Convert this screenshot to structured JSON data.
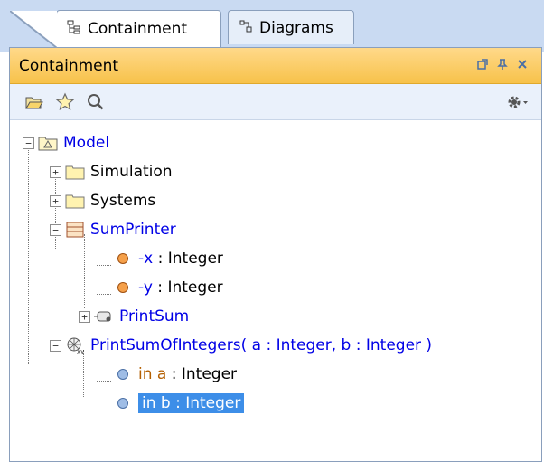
{
  "tabs": [
    {
      "label": "Containment",
      "icon": "containment-tree-icon",
      "active": true
    },
    {
      "label": "Diagrams",
      "icon": "diagram-icon",
      "active": false
    }
  ],
  "panel": {
    "title": "Containment",
    "titlebar_buttons": [
      "restore-icon",
      "pin-icon",
      "close-icon"
    ]
  },
  "toolbar": {
    "buttons": [
      "open-folder-icon",
      "star-icon",
      "search-icon"
    ],
    "options": "gear-icon"
  },
  "tree": {
    "model": "Model",
    "simulation": "Simulation",
    "systems": "Systems",
    "sumprinter": "SumPrinter",
    "attr_x_name": "-x",
    "attr_x_type": " : Integer",
    "attr_y_name": "-y",
    "attr_y_type": " : Integer",
    "printsum": "PrintSum",
    "op": "PrintSumOfIntegers( a : Integer, b : Integer )",
    "param_a_name": "in a",
    "param_a_type": " : Integer",
    "param_b": "in b : Integer"
  },
  "colors": {
    "tab_strip": "#c9daf2",
    "title_bar": "#f7c24a",
    "selection": "#3d8ee8",
    "element_blue": "#0000e6",
    "attribute_orange": "#b45f00"
  }
}
